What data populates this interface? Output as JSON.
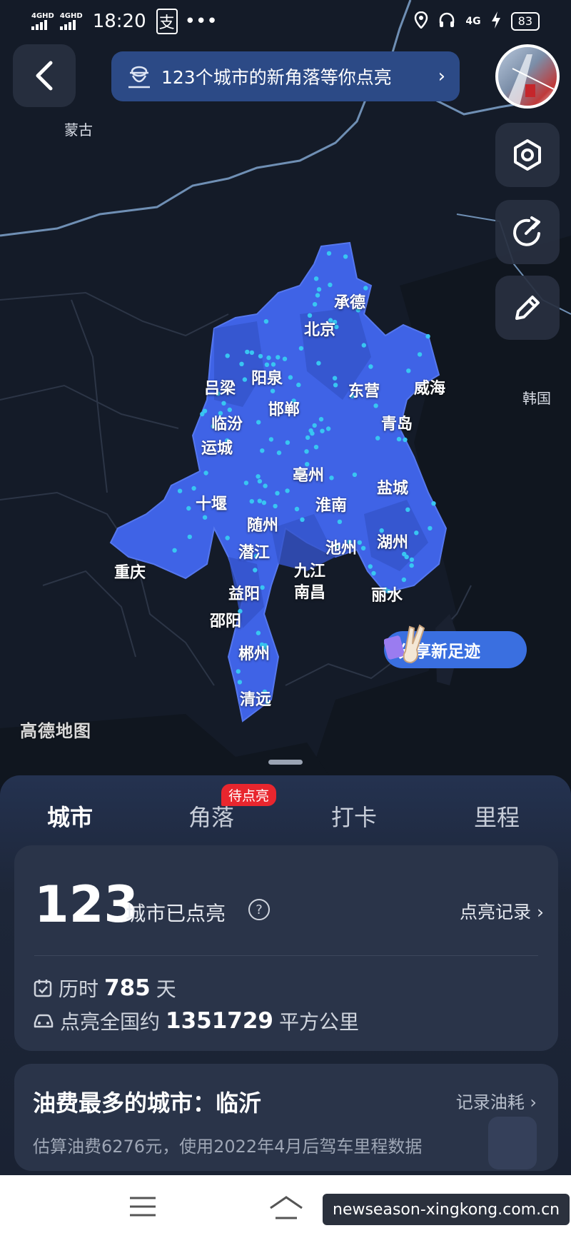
{
  "status_bar": {
    "signal_1": "4GHD",
    "signal_2": "4GHD",
    "time": "18:20",
    "app_icon": "支",
    "more": "•••",
    "network": "4G",
    "battery": "83"
  },
  "header": {
    "banner_text": "123个城市的新角落等你点亮"
  },
  "map": {
    "countries": [
      "蒙古",
      "韩国"
    ],
    "cities": [
      "承德",
      "北京",
      "吕梁",
      "阳泉",
      "邯郸",
      "东营",
      "威海",
      "临汾",
      "青岛",
      "运城",
      "亳州",
      "盐城",
      "十堰",
      "淮南",
      "随州",
      "湖州",
      "重庆",
      "潜江",
      "池州",
      "九江",
      "南昌",
      "丽水",
      "益阳",
      "邵阳",
      "郴州",
      "清远"
    ],
    "provider_watermark": "高德地图",
    "share_button": "分享新足迹",
    "lit_color": "#3f63e6",
    "dot_color": "#38c6f2"
  },
  "tabs": [
    {
      "label": "城市",
      "active": true
    },
    {
      "label": "角落",
      "badge": "待点亮"
    },
    {
      "label": "打卡"
    },
    {
      "label": "里程"
    }
  ],
  "summary": {
    "count": "123",
    "count_label": "城市已点亮",
    "record_link": "点亮记录",
    "days_prefix": "历时",
    "days_value": "785",
    "days_unit": "天",
    "area_prefix": "点亮全国约",
    "area_value": "1351729",
    "area_unit": "平方公里"
  },
  "fuel_card": {
    "title": "油费最多的城市：临沂",
    "link": "记录油耗",
    "description": "估算油费6276元，使用2022年4月后驾车里程数据"
  },
  "watermark": "newseason-xingkong.com.cn"
}
